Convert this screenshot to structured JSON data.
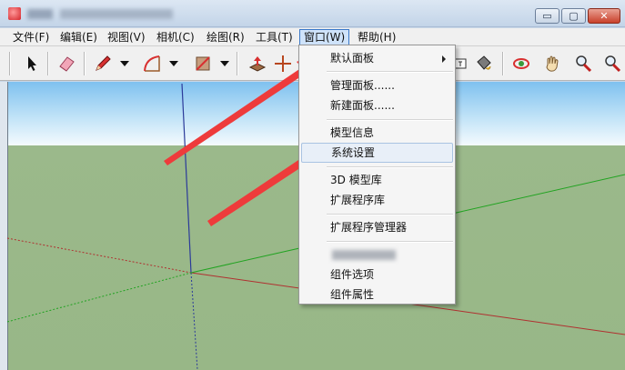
{
  "menubar": {
    "items": [
      {
        "label": "文件(F)"
      },
      {
        "label": "编辑(E)"
      },
      {
        "label": "视图(V)"
      },
      {
        "label": "相机(C)"
      },
      {
        "label": "绘图(R)"
      },
      {
        "label": "工具(T)"
      },
      {
        "label": "窗口(W)"
      },
      {
        "label": "帮助(H)"
      }
    ]
  },
  "titlebar": {
    "minimize": "▭",
    "maximize": "▢",
    "close": "✕"
  },
  "window_menu": {
    "items": [
      {
        "label": "默认面板"
      },
      {
        "label": "管理面板......"
      },
      {
        "label": "新建面板......"
      },
      {
        "label": "模型信息"
      },
      {
        "label": "系统设置"
      },
      {
        "label": "3D 模型库"
      },
      {
        "label": "扩展程序库"
      },
      {
        "label": "扩展程序管理器"
      },
      {
        "label": "组件选项"
      },
      {
        "label": "组件属性"
      }
    ]
  },
  "colors": {
    "annotation_arrow": "#ee3b3b",
    "axis_red": "#b03030",
    "axis_green": "#21a321",
    "axis_blue": "#2b3a9a"
  }
}
